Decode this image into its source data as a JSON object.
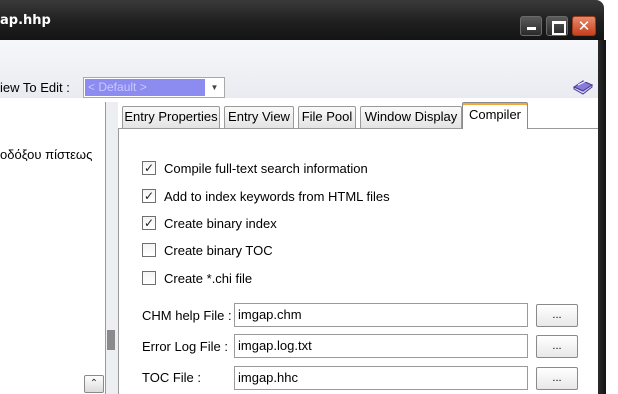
{
  "window": {
    "title": "ap.hhp",
    "close_glyph": "✕"
  },
  "toolbar": {
    "view_label": "iew To Edit :",
    "view_selected": "< Default >",
    "help_icon": "book-icon"
  },
  "left_panel": {
    "item_text": "οδόξου πίστεως",
    "scroll_up_glyph": "⌃"
  },
  "tabs": [
    {
      "label": "Entry Properties",
      "active": false
    },
    {
      "label": "Entry View",
      "active": false
    },
    {
      "label": "File Pool",
      "active": false
    },
    {
      "label": "Window Display",
      "active": false
    },
    {
      "label": "Compiler",
      "active": true
    }
  ],
  "compiler": {
    "checkboxes": [
      {
        "label": "Compile full-text search information",
        "checked": true
      },
      {
        "label": "Add to index keywords from HTML files",
        "checked": true
      },
      {
        "label": "Create binary index",
        "checked": true
      },
      {
        "label": "Create binary TOC",
        "checked": false
      },
      {
        "label": "Create *.chi file",
        "checked": false
      }
    ],
    "fields": [
      {
        "label": "CHM help File :",
        "value": "imgap.chm",
        "button": "..."
      },
      {
        "label": "Error Log File :",
        "value": "imgap.log.txt",
        "button": "..."
      },
      {
        "label": "TOC File :",
        "value": "imgap.hhc",
        "button": "..."
      }
    ]
  },
  "colors": {
    "titlebar": "#1f1f1f",
    "close_button": "#c8401c",
    "selection": "#8c8cf0",
    "active_tab_accent": "#f3a73b"
  }
}
